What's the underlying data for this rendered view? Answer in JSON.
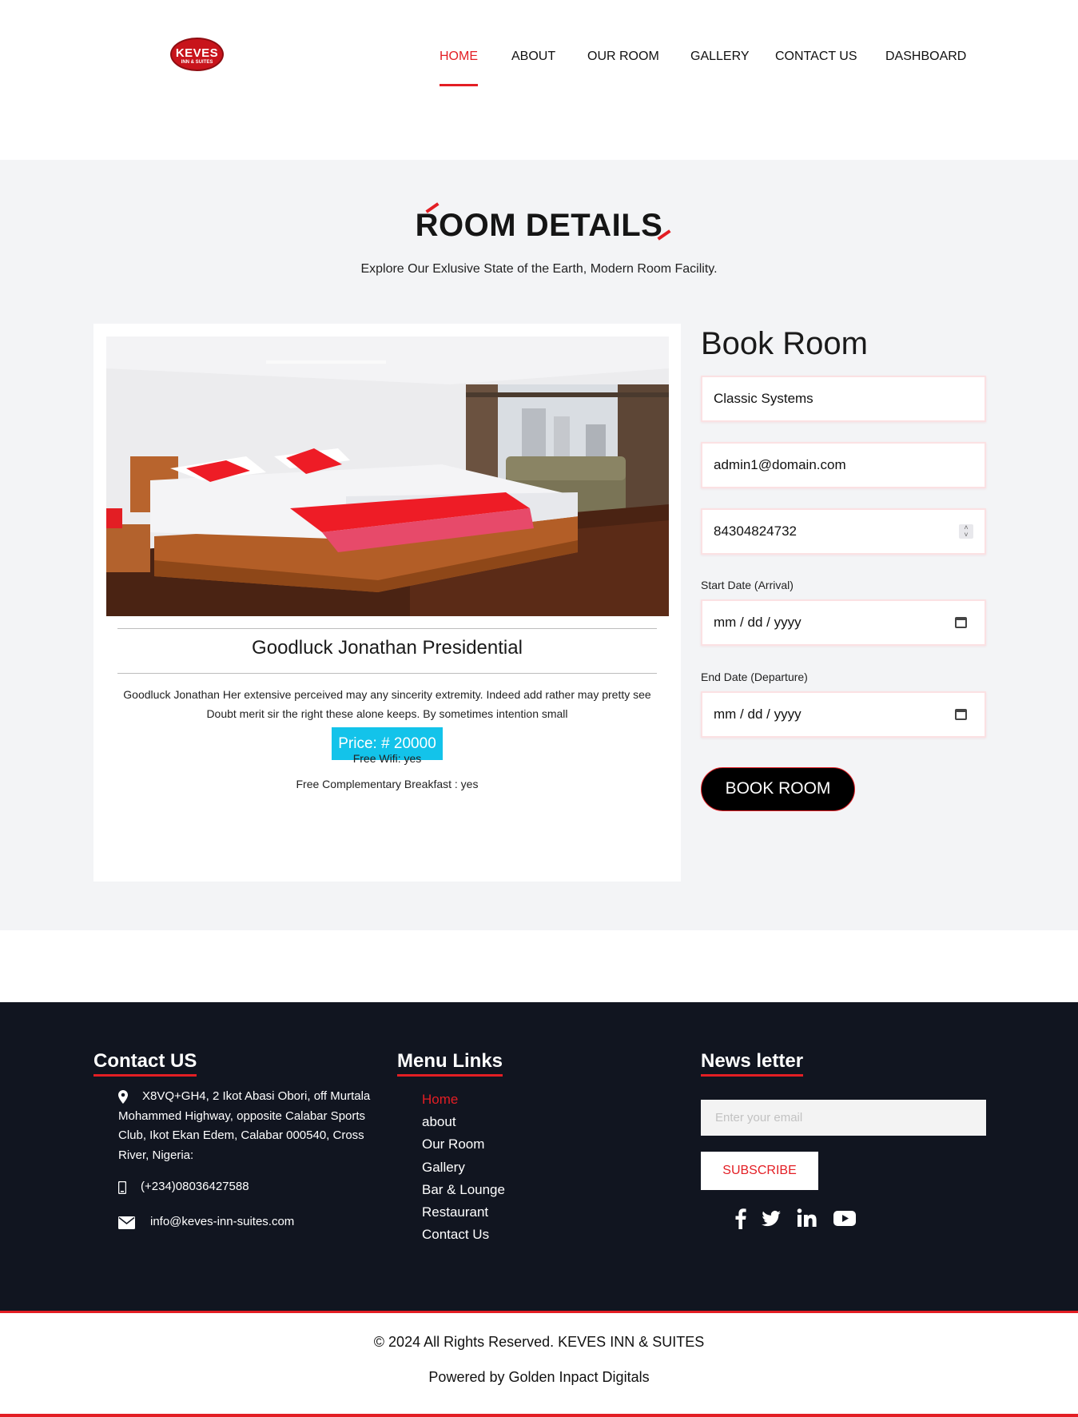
{
  "stray_char": ";",
  "logo": {
    "line1": "KEVES",
    "line2": "INN & SUITES"
  },
  "nav": {
    "items": [
      {
        "label": "HOME",
        "active": true
      },
      {
        "label": "ABOUT"
      },
      {
        "label": "OUR ROOM"
      },
      {
        "label": "GALLERY"
      },
      {
        "label": "CONTACT US"
      },
      {
        "label": "DASHBOARD"
      }
    ]
  },
  "section": {
    "title": "ROOM DETAILS",
    "subtitle": "Explore Our Exlusive State of the Earth, Modern Room Facility."
  },
  "room": {
    "name": "Goodluck Jonathan Presidential",
    "description": "Goodluck Jonathan Her extensive perceived may any sincerity extremity. Indeed add rather may pretty see Doubt merit sir the right these alone keeps. By sometimes intention small",
    "price": "Price: # 20000",
    "wifi": "Free Wifi: yes",
    "breakfast": "Free Complementary Breakfast : yes"
  },
  "booking": {
    "title": "Book Room",
    "name_value": "Classic Systems",
    "email_value": "admin1@domain.com",
    "phone_value": "84304824732",
    "start_label": "Start Date (Arrival)",
    "start_value": "mm / dd / yyyy",
    "end_label": "End Date (Departure)",
    "end_value": "mm / dd / yyyy",
    "button": "BOOK ROOM"
  },
  "footer": {
    "contact_title": "Contact US",
    "address": "X8VQ+GH4, 2 Ikot Abasi Obori, off Murtala Mohammed Highway, opposite Calabar Sports Club, Ikot Ekan Edem, Calabar 000540, Cross River, Nigeria:",
    "phone": "(+234)08036427588",
    "email": "info@keves-inn-suites.com",
    "menu_title": "Menu Links",
    "menu": [
      {
        "label": "Home",
        "active": true
      },
      {
        "label": "about"
      },
      {
        "label": "Our Room"
      },
      {
        "label": "Gallery"
      },
      {
        "label": "Bar & Lounge"
      },
      {
        "label": "Restaurant"
      },
      {
        "label": "Contact Us"
      }
    ],
    "newsletter_title": "News letter",
    "email_placeholder": "Enter your email",
    "subscribe": "SUBSCRIBE",
    "social": [
      "facebook-icon",
      "twitter-icon",
      "linkedin-icon",
      "youtube-icon"
    ]
  },
  "copyright": "© 2024 All Rights Reserved. KEVES INN & SUITES",
  "powered": "Powered by Golden Inpact Digitals",
  "colors": {
    "accent": "#e31e24",
    "footer_bg": "#111520",
    "price_badge": "#13c3ea",
    "section_bg": "#f3f4f6"
  }
}
